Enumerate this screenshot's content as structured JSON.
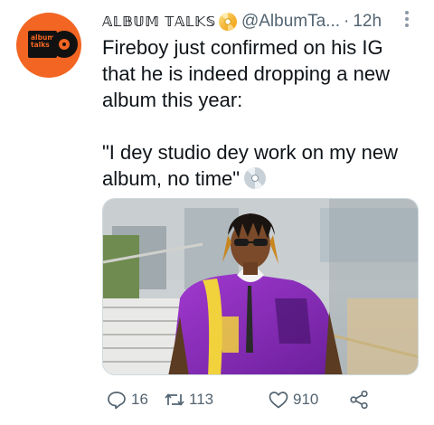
{
  "account": {
    "avatar_line1": "album",
    "avatar_line2": "talks",
    "display_name": "𝔸𝕃𝔹𝕌𝕄 𝕋𝔸𝕃𝕂𝕊",
    "badge_icon": "cd-icon",
    "handle": "@AlbumTa...",
    "separator": "·",
    "timestamp": "12h"
  },
  "tweet": {
    "line1": "Fireboy just confirmed on his IG that he is indeed dropping a new album this year:",
    "quote": "\"I dey studio dey work on my new album, no time\"",
    "quote_emoji": "cd-icon"
  },
  "media": {
    "type": "photo"
  },
  "actions": {
    "reply_count": "16",
    "retweet_count": "113",
    "like_count": "910"
  },
  "colors": {
    "brand_orange": "#f26522",
    "muted": "#536471",
    "text": "#0f1419"
  }
}
